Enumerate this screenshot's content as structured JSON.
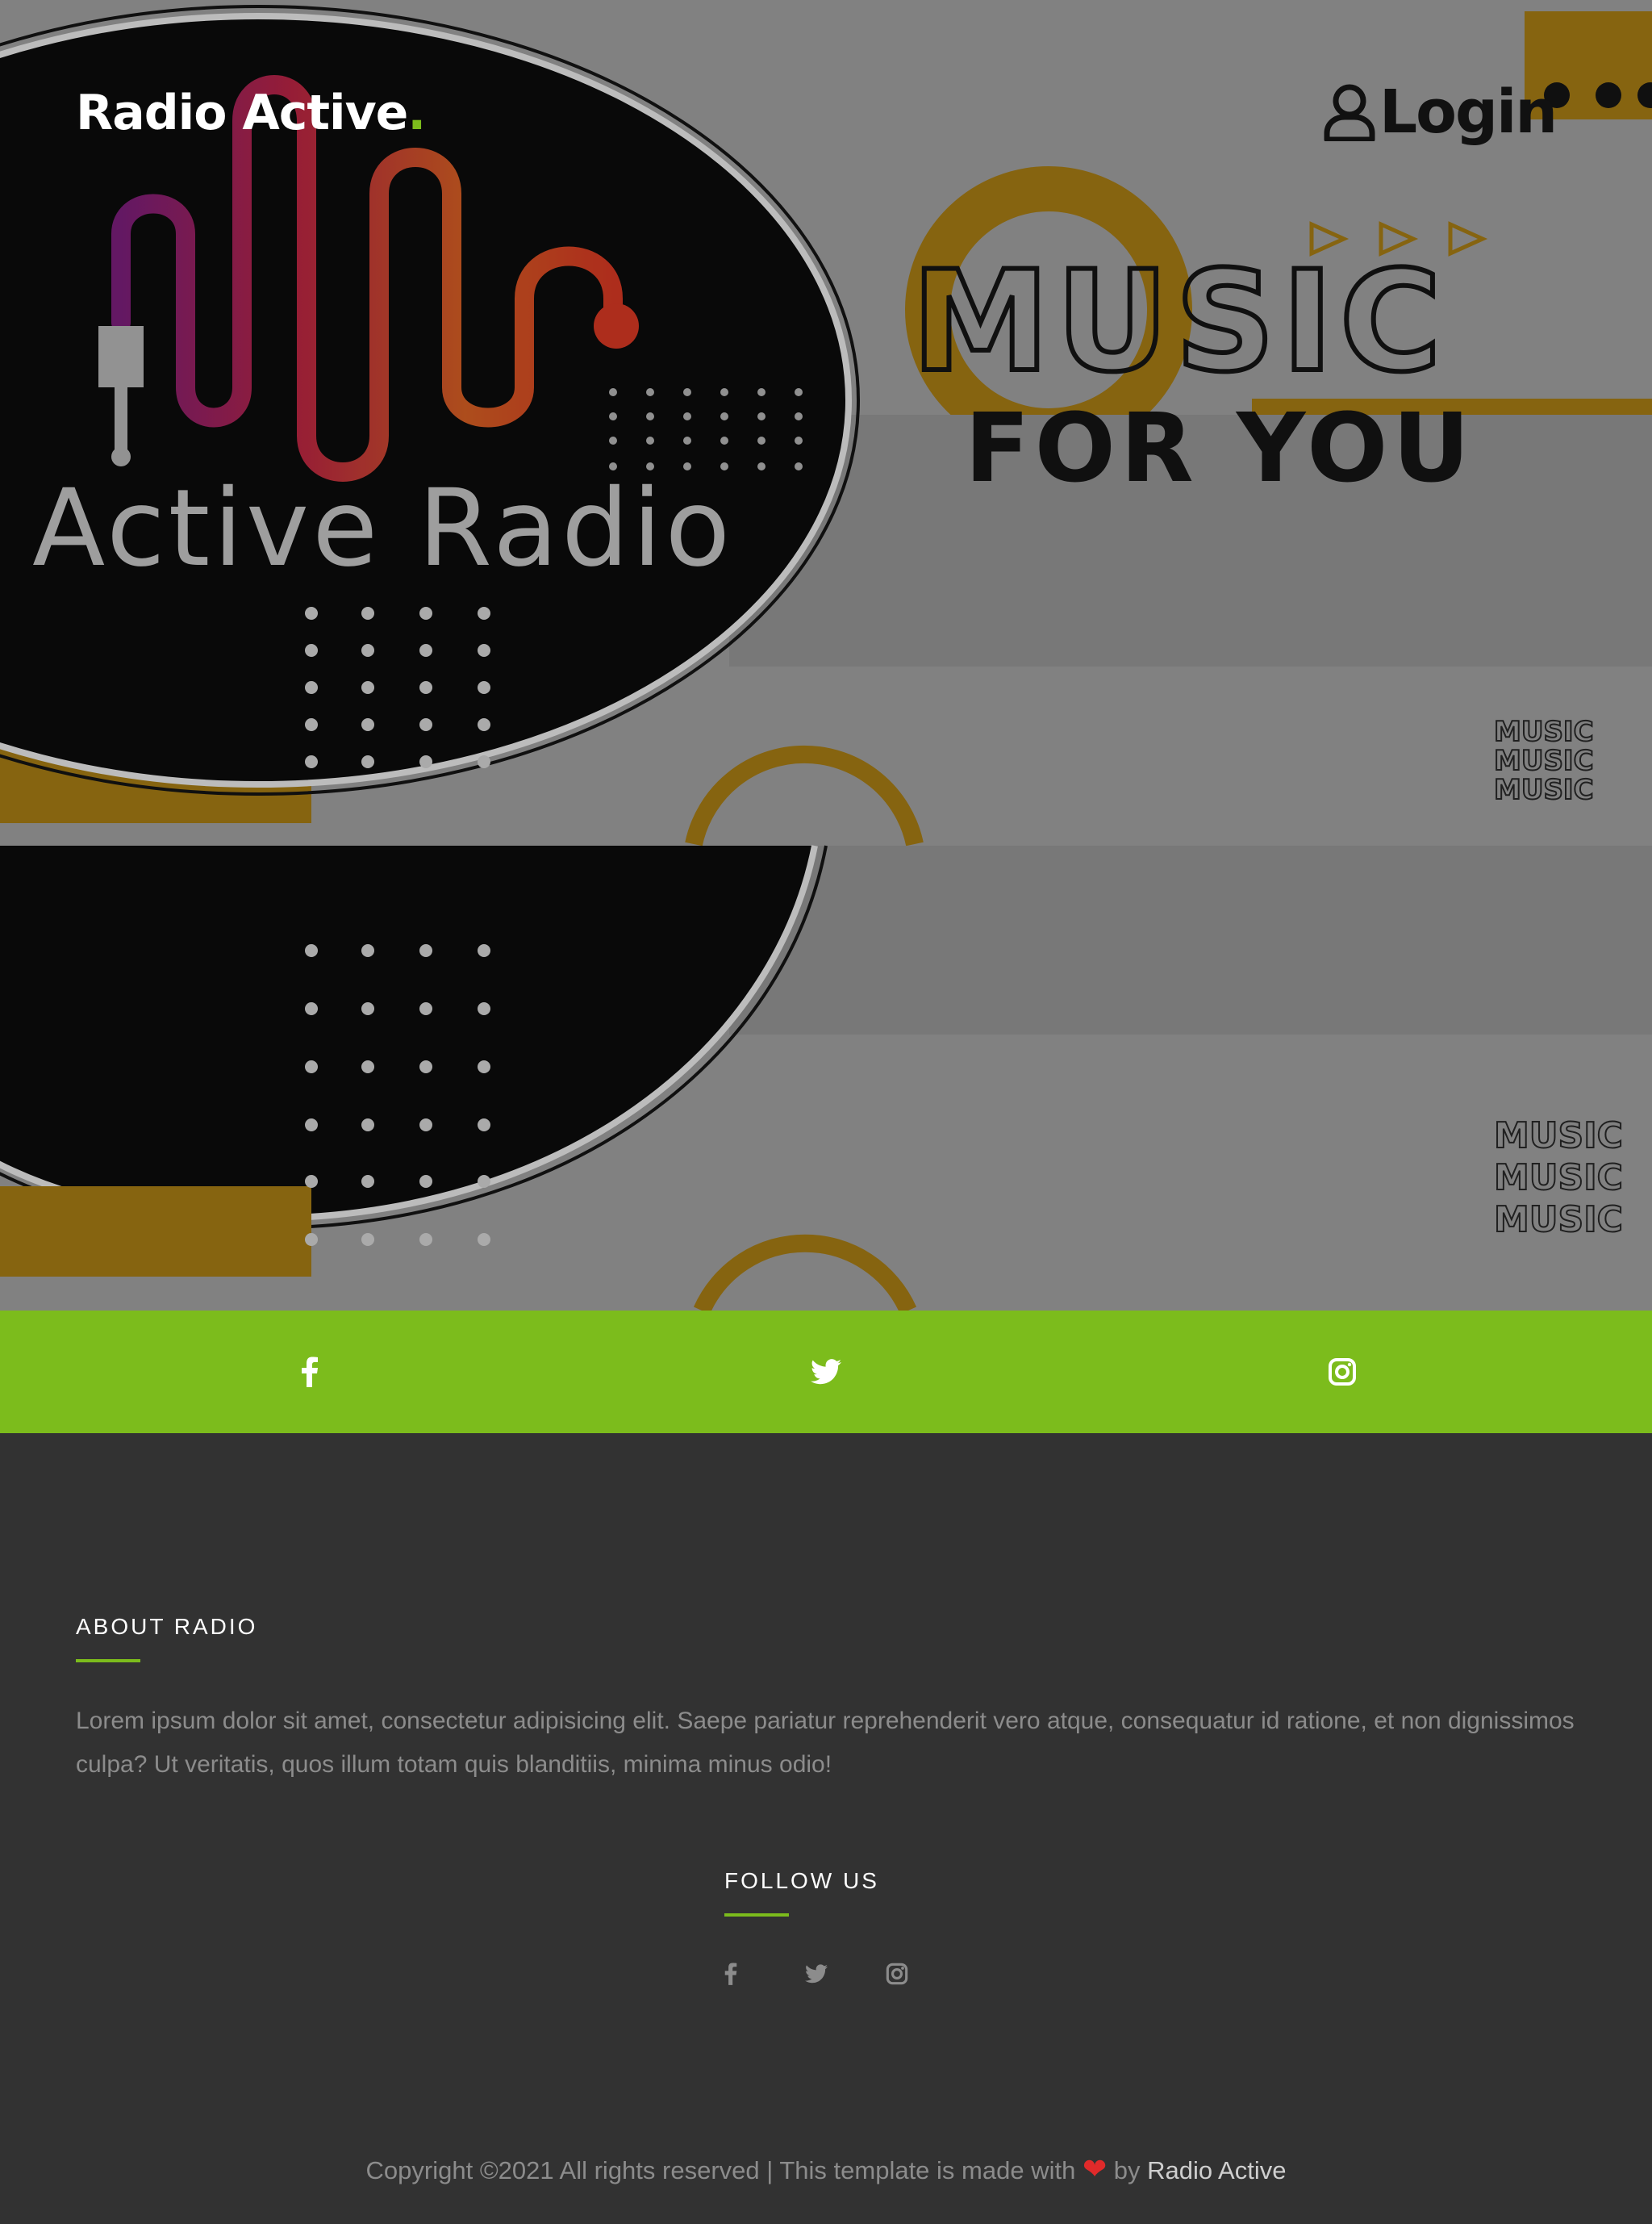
{
  "header": {
    "brand_name": "Radio Active",
    "brand_dot": ".",
    "login_label": "Login"
  },
  "hero": {
    "logo_title": "Active Radio",
    "poster_line_1": "MUSIC",
    "poster_line_2": "FOR YOU",
    "small_music": "MUSIC"
  },
  "social_strip": {
    "icons": [
      "facebook-icon",
      "twitter-icon",
      "instagram-icon"
    ]
  },
  "footer": {
    "about_heading": "ABOUT RADIO",
    "about_text": "Lorem ipsum dolor sit amet, consectetur adipisicing elit. Saepe pariatur reprehenderit vero atque, consequatur id ratione, et non dignissimos culpa? Ut veritatis, quos illum totam quis blanditiis, minima minus odio!",
    "follow_heading": "FOLLOW US",
    "follow_icons": [
      "facebook-icon",
      "twitter-icon",
      "instagram-icon"
    ],
    "copyright_prefix": "Copyright ©2021 All rights reserved | This template is made with",
    "copyright_by": "by",
    "copyright_author": "Radio Active"
  },
  "colors": {
    "accent": "#7cbc1c",
    "footer_bg": "#323232",
    "heart": "#e02a2a",
    "poster_yellow": "#8f6b12"
  }
}
